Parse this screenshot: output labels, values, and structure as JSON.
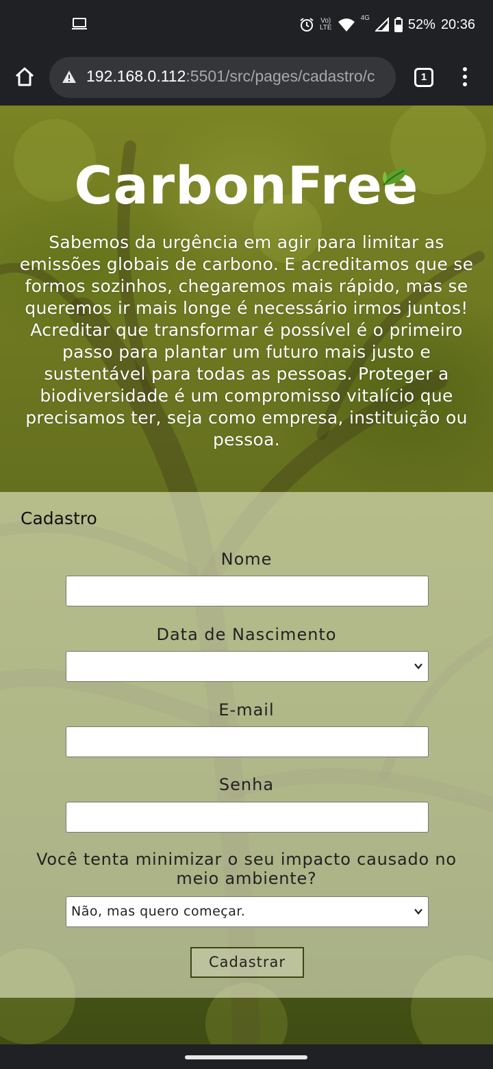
{
  "status_bar": {
    "battery": "52%",
    "time": "20:36",
    "network_label": "4G",
    "volte_label_top": "Vo)",
    "volte_label_bottom": "LTE"
  },
  "browser": {
    "url_host": "192.168.0.112",
    "url_path": ":5501/src/pages/cadastro/c",
    "tab_count": "1"
  },
  "hero": {
    "logo": "CarbonFree",
    "description": "Sabemos da urgência em agir para limitar as emissões globais de carbono. E acreditamos que se formos sozinhos, chegaremos mais rápido, mas se queremos ir mais longe é necessário irmos juntos! Acreditar que transformar é possível é o primeiro passo para plantar um futuro mais justo e sustentável para todas as pessoas. Proteger a biodiversidade é um compromisso vitalício que precisamos ter, seja como empresa, instituição ou pessoa."
  },
  "form": {
    "title": "Cadastro",
    "name_label": "Nome",
    "name_value": "",
    "birth_label": "Data de Nascimento",
    "birth_value": "",
    "email_label": "E-mail",
    "email_value": "",
    "password_label": "Senha",
    "password_value": "",
    "impact_question": "Você tenta minimizar o seu impacto causado no meio ambiente?",
    "impact_value": "Não, mas quero começar.",
    "submit_label": "Cadastrar"
  },
  "colors": {
    "accent_dark": "#3d4412",
    "leaf_green": "#5aa02c",
    "chrome_bg": "#202124"
  }
}
